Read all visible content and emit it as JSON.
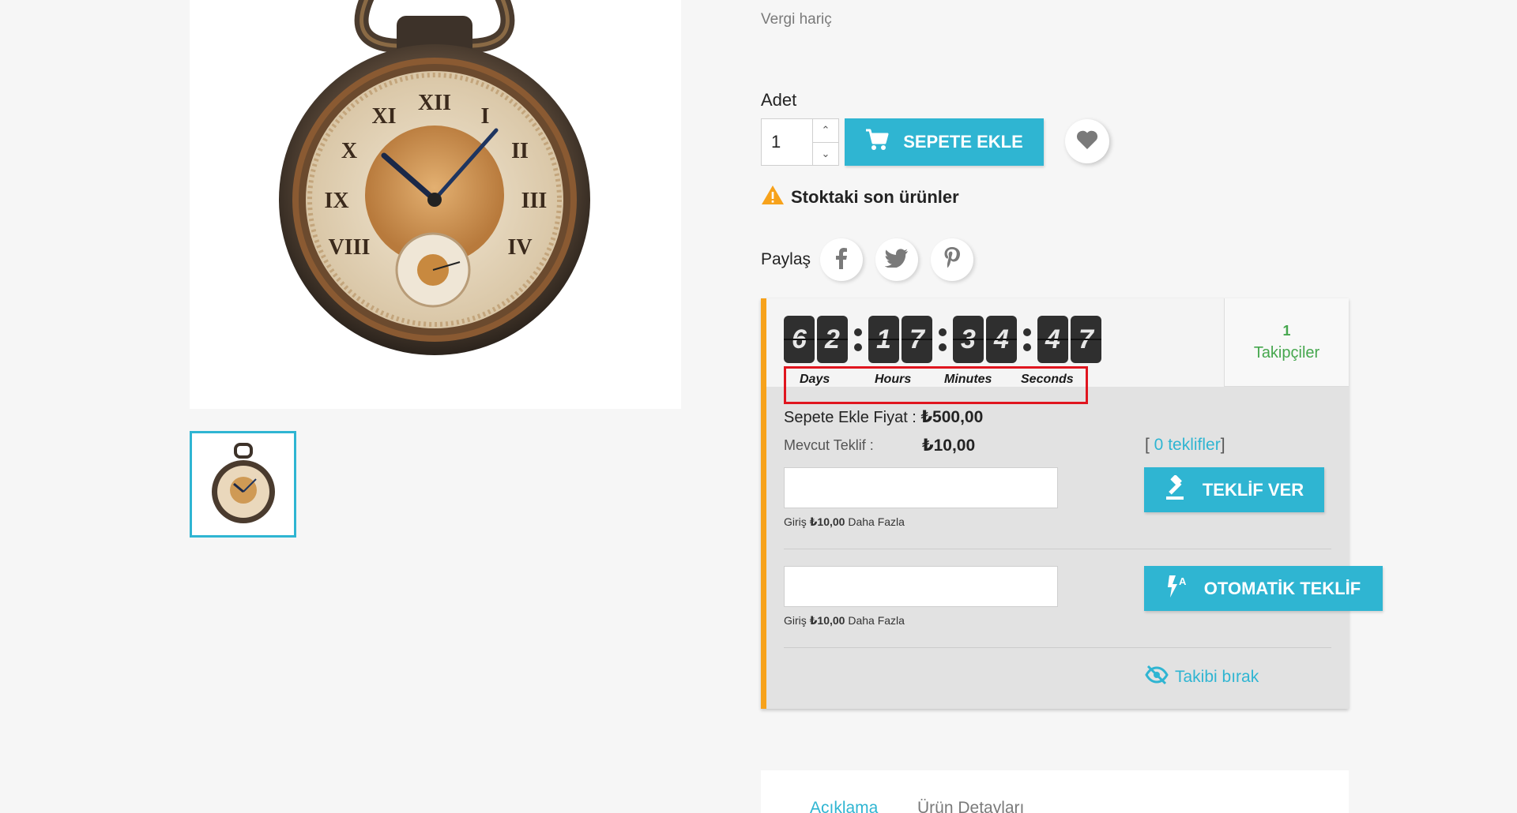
{
  "product": {
    "tax_label": "Vergi hariç",
    "quantity_label": "Adet",
    "quantity_value": "1",
    "add_to_cart_label": "SEPETE EKLE",
    "stock_message": "Stoktaki son ürünler",
    "share_label": "Paylaş"
  },
  "auction": {
    "countdown_digits": [
      "6",
      "2",
      "1",
      "7",
      "3",
      "4",
      "4",
      "7"
    ],
    "countdown_labels": {
      "days": "Days",
      "hours": "Hours",
      "minutes": "Minutes",
      "seconds": "Seconds"
    },
    "followers_count": "1",
    "followers_label": "Takipçiler",
    "buy_now_label": "Sepete Ekle Fiyat :",
    "buy_now_price": "₺500,00",
    "current_bid_label": "Mevcut Teklif :",
    "current_bid_value": "₺10,00",
    "bids_bracket_open": "[",
    "bids_link": " 0 teklifler",
    "bids_bracket_close": "]",
    "bid_hint_prefix": "Giriş",
    "bid_hint_amount": "₺10,00",
    "bid_hint_suffix": "Daha Fazla",
    "place_bid_label": "TEKLİF VER",
    "auto_bid_label": "OTOMATİK TEKLİF",
    "unfollow_label": "Takibi bırak"
  },
  "tabs": [
    "Açıklama",
    "Ürün Detayları"
  ],
  "colors": {
    "accent": "#2fb5d2",
    "warning": "#f7a21b",
    "followers": "#46a74e",
    "highlight_box": "#e0151f"
  },
  "icons": [
    "cart-icon",
    "heart-icon",
    "warning-icon",
    "facebook-icon",
    "twitter-icon",
    "pinterest-icon",
    "gavel-icon",
    "auto-bid-icon",
    "eye-slash-icon"
  ]
}
